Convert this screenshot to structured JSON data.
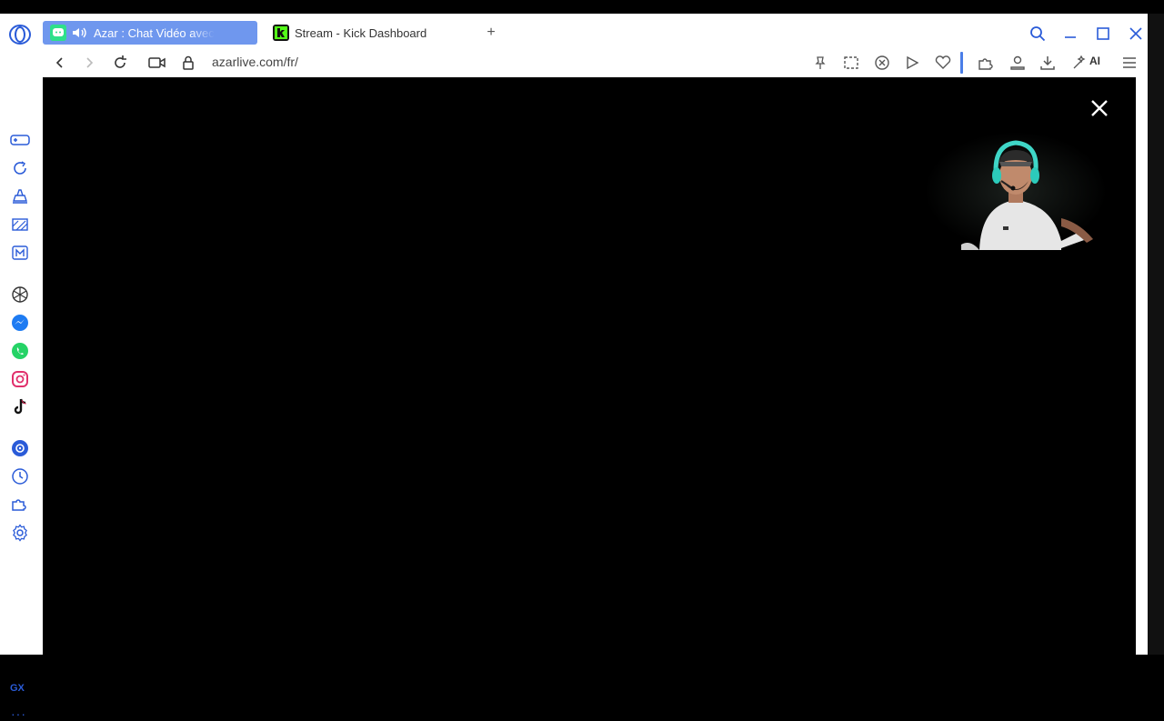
{
  "tabs": [
    {
      "title": "Azar : Chat Vidéo avec",
      "active": true,
      "favicon": "azar-chat-icon",
      "audio": "speaker-icon"
    },
    {
      "title": "Stream - Kick Dashboard",
      "active": false,
      "favicon": "kick-k-icon"
    }
  ],
  "new_tab": "+",
  "address": {
    "url": "azarlive.com/fr/"
  },
  "toolbar": {
    "ai_label": "AI"
  },
  "sidebar_bottom": {
    "gx": "GX",
    "more": "···"
  },
  "colors": {
    "active_tab": "#6f97ee",
    "accent": "#2a5bd8",
    "kick_green": "#53fc18",
    "content_bg": "#000000"
  }
}
